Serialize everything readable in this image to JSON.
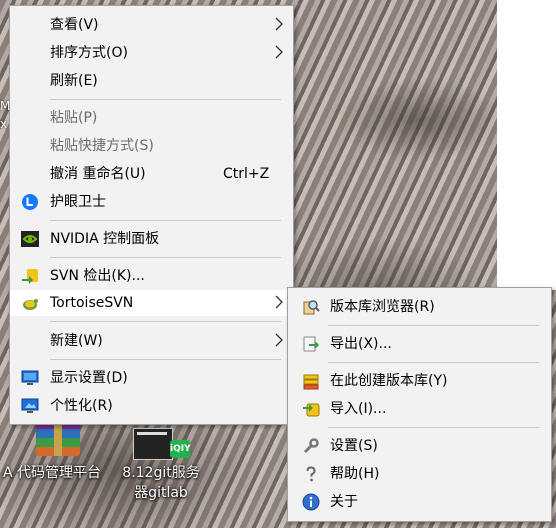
{
  "desktop": {
    "icons": [
      {
        "label": "A 代码管理平台"
      },
      {
        "label": "8.12git服务器gitlab"
      }
    ],
    "left_edge_text": "M\nx",
    "right_edge_text": "\\",
    "iqiyi_badge": "iQIY"
  },
  "context_menu": {
    "items": [
      {
        "label": "查看(V)"
      },
      {
        "label": "排序方式(O)"
      },
      {
        "label": "刷新(E)"
      },
      {
        "label": "粘贴(P)"
      },
      {
        "label": "粘贴快捷方式(S)"
      },
      {
        "label": "撤消 重命名(U)",
        "shortcut": "Ctrl+Z"
      },
      {
        "label": "护眼卫士"
      },
      {
        "label": "NVIDIA 控制面板"
      },
      {
        "label": "SVN 检出(K)..."
      },
      {
        "label": "TortoiseSVN"
      },
      {
        "label": "新建(W)"
      },
      {
        "label": "显示设置(D)"
      },
      {
        "label": "个性化(R)"
      }
    ]
  },
  "tortoise_submenu": {
    "items": [
      {
        "label": "版本库浏览器(R)"
      },
      {
        "label": "导出(X)..."
      },
      {
        "label": "在此创建版本库(Y)"
      },
      {
        "label": "导入(I)..."
      },
      {
        "label": "设置(S)"
      },
      {
        "label": "帮助(H)"
      },
      {
        "label": "关于"
      }
    ]
  },
  "colors": {
    "menu_bg": "#f2f2f2",
    "hover_bg": "#ffffff",
    "disabled_text": "#6d6d6d",
    "separator": "#c8c8c8"
  }
}
